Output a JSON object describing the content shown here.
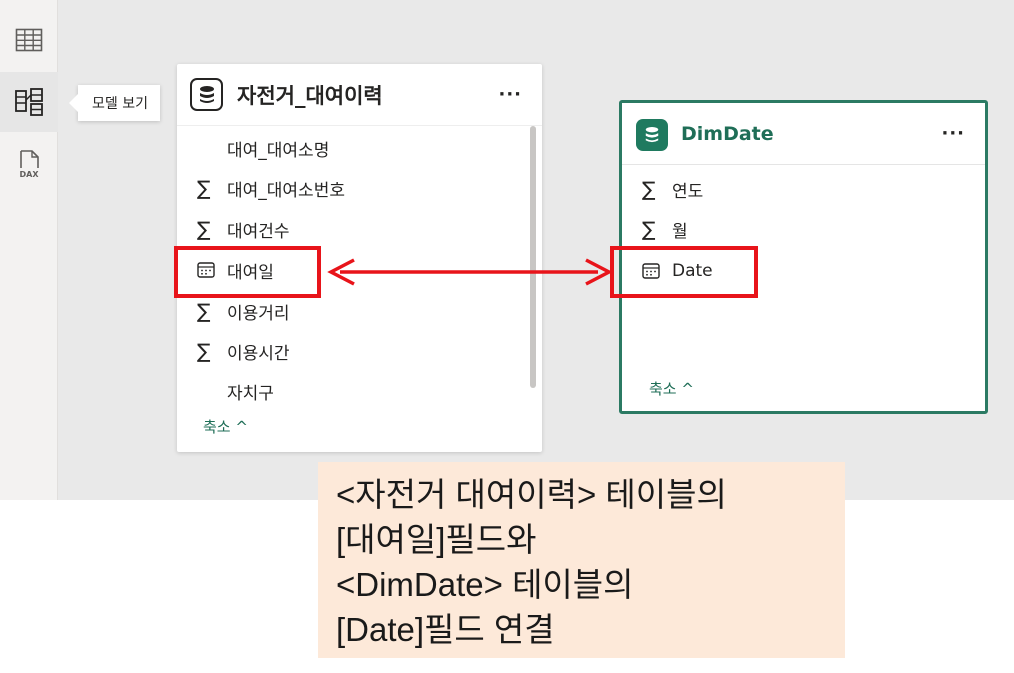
{
  "rail": {
    "items": [
      {
        "icon": "table-view-icon"
      },
      {
        "icon": "model-view-icon",
        "active": true
      },
      {
        "icon": "dax-query-icon",
        "badge": "DAX"
      }
    ],
    "tooltip": "모델 보기"
  },
  "tables": [
    {
      "title": "자전거_대여이력",
      "more": "···",
      "fields": [
        {
          "type": "text",
          "name": "대여_대여소명"
        },
        {
          "type": "sum",
          "name": "대여_대여소번호"
        },
        {
          "type": "sum",
          "name": "대여건수"
        },
        {
          "type": "date",
          "name": "대여일"
        },
        {
          "type": "sum",
          "name": "이용거리"
        },
        {
          "type": "sum",
          "name": "이용시간"
        },
        {
          "type": "text",
          "name": "자치구"
        }
      ],
      "collapse": "축소 ^"
    },
    {
      "title": "DimDate",
      "more": "···",
      "fields": [
        {
          "type": "sum",
          "name": "연도"
        },
        {
          "type": "sum",
          "name": "월"
        },
        {
          "type": "date",
          "name": "Date"
        }
      ],
      "collapse": "축소 ^"
    }
  ],
  "symbols": {
    "sum": "∑"
  },
  "colors": {
    "highlight": "#e8141a",
    "accent": "#1f6e57",
    "note_bg": "#fde9d9"
  },
  "note": {
    "lines": [
      "<자전거 대여이력> 테이블의",
      "[대여일]필드와",
      "<DimDate> 테이블의",
      "[Date]필드 연결"
    ]
  }
}
